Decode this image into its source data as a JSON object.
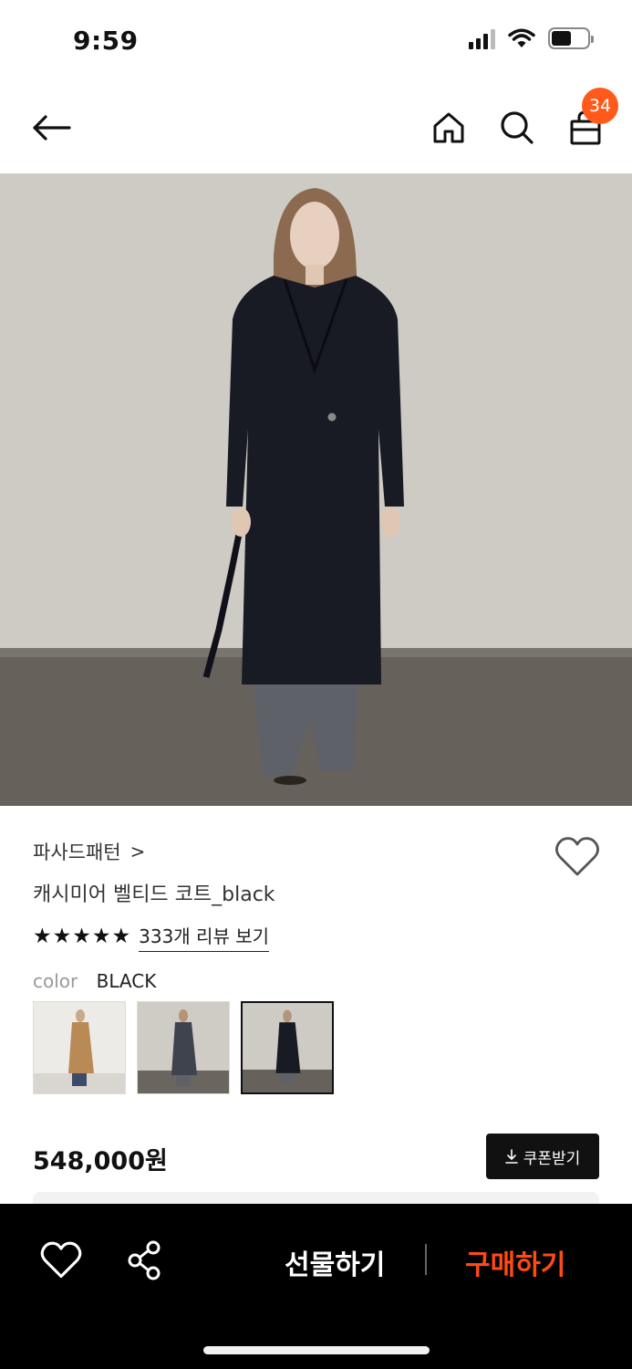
{
  "status_bar": {
    "time": "9:59"
  },
  "nav": {
    "cart_badge": "34"
  },
  "product": {
    "brand": "파사드패턴",
    "brand_chevron": ">",
    "title": "캐시미어 벨티드 코트_black",
    "rating_stars": 5,
    "review_link": "333개 리뷰 보기",
    "color_label": "color",
    "color_value": "BLACK",
    "swatches": [
      {
        "color": "camel",
        "selected": false
      },
      {
        "color": "charcoal",
        "selected": false
      },
      {
        "color": "black",
        "selected": true
      }
    ],
    "price": "548,000원",
    "coupon_label": "쿠폰받기"
  },
  "bottom_bar": {
    "gift_label": "선물하기",
    "buy_label": "구매하기"
  },
  "colors": {
    "accent": "#ff5a1a",
    "buy": "#ff4a12",
    "bar_bg": "#000000"
  }
}
